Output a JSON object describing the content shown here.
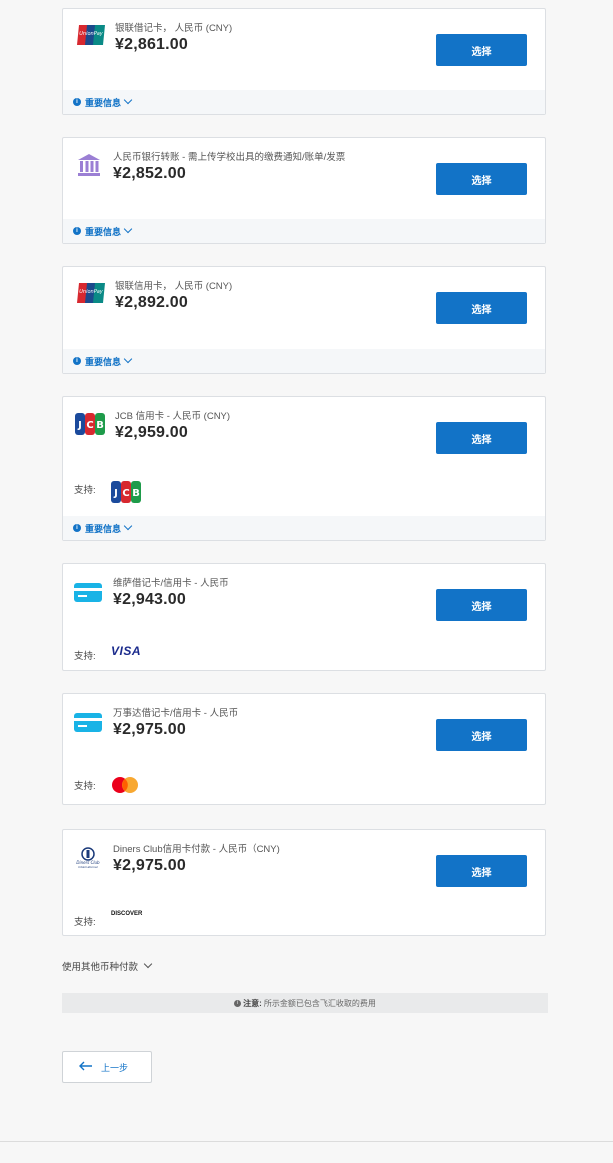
{
  "options": [
    {
      "description": "银联借记卡， 人民币 (CNY)",
      "price": "¥2,861.00",
      "select_label": "选择",
      "info_label": "重要信息",
      "logo": "unionpay-icon"
    },
    {
      "description": "人民币银行转账 - 需上传学校出具的缴费通知/账单/发票",
      "price": "¥2,852.00",
      "select_label": "选择",
      "info_label": "重要信息",
      "logo": "bank-icon"
    },
    {
      "description": "银联信用卡， 人民币 (CNY)",
      "price": "¥2,892.00",
      "select_label": "选择",
      "info_label": "重要信息",
      "logo": "unionpay-icon"
    },
    {
      "description": "JCB 信用卡 - 人民币 (CNY)",
      "price": "¥2,959.00",
      "select_label": "选择",
      "info_label": "重要信息",
      "support_label": "支持:",
      "logo": "jcb-icon"
    },
    {
      "description": "维萨借记卡/信用卡 - 人民币",
      "price": "¥2,943.00",
      "select_label": "选择",
      "support_label": "支持:",
      "support_text": "VISA",
      "logo": "credit-card-icon"
    },
    {
      "description": "万事达借记卡/信用卡 - 人民币",
      "price": "¥2,975.00",
      "select_label": "选择",
      "support_label": "支持:",
      "logo": "credit-card-icon"
    },
    {
      "description": "Diners Club信用卡付款 - 人民币（CNY)",
      "price": "¥2,975.00",
      "select_label": "选择",
      "support_label": "支持:",
      "support_text": "DISCOVER",
      "logo": "diners-club-icon"
    }
  ],
  "other_currency_label": "使用其他币种付款",
  "note": {
    "label": "注意:",
    "text": "所示金额已包含飞汇收取的费用"
  },
  "back_label": "上一步",
  "colors": {
    "accent": "#1273c7",
    "background": "#f7f7f7"
  }
}
